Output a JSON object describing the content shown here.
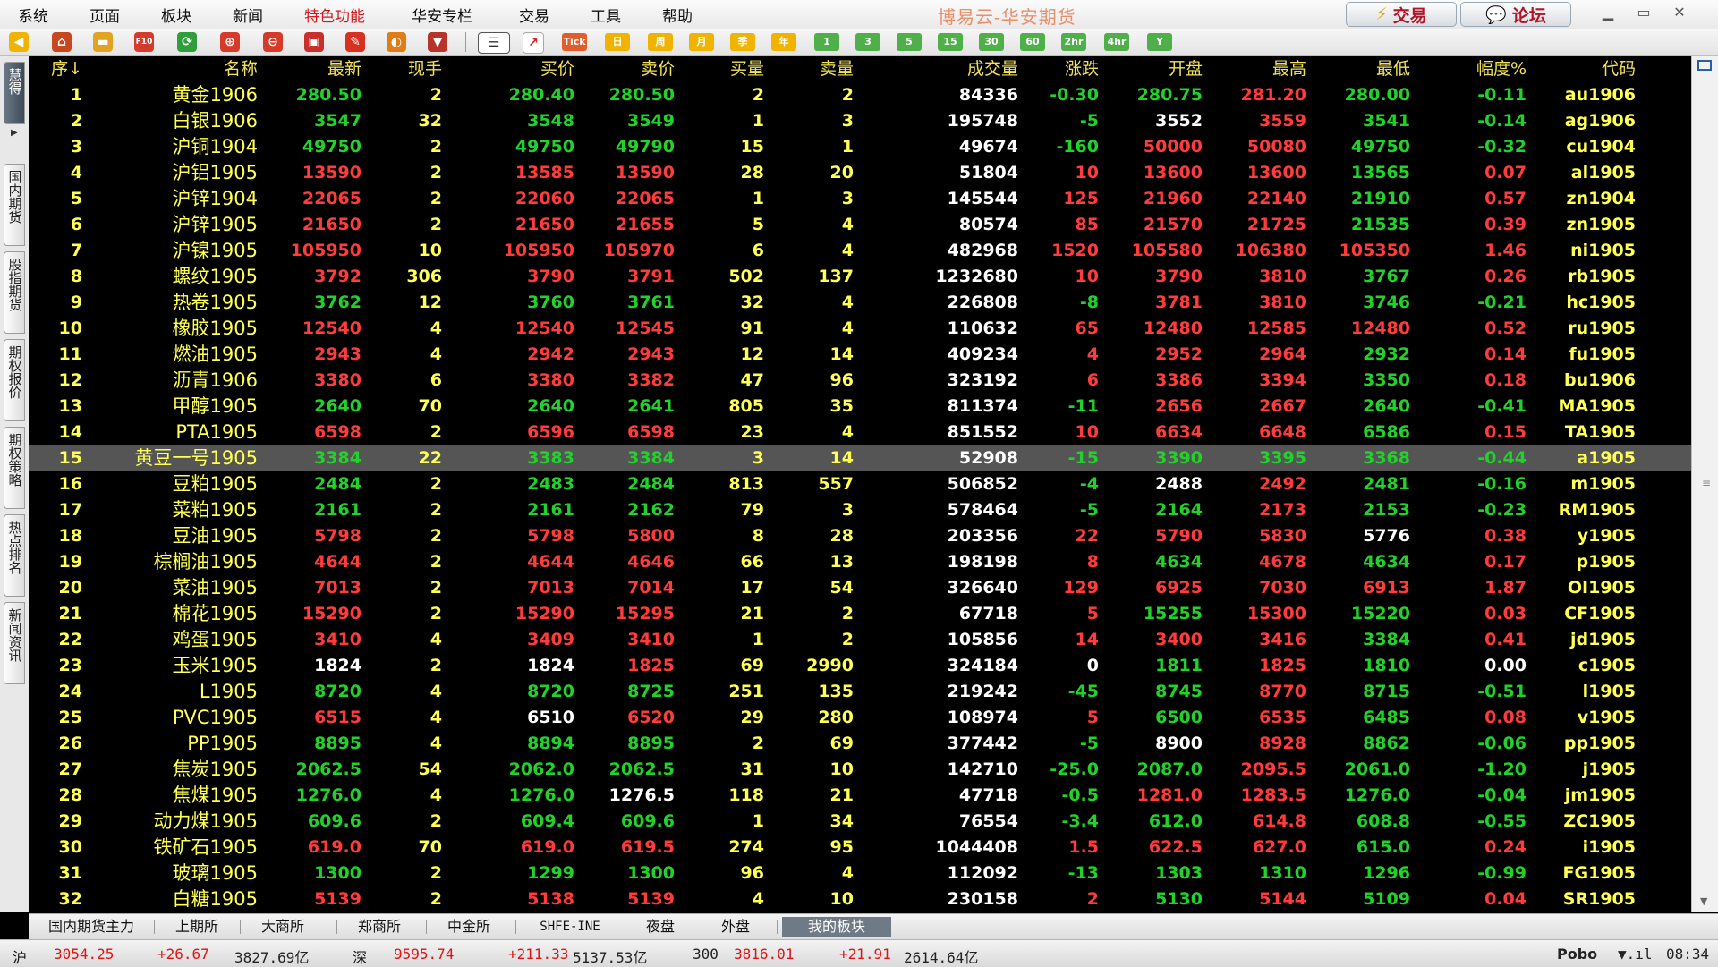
{
  "menu": {
    "items": [
      "系统",
      "页面",
      "板块",
      "新闻",
      "特色功能",
      "华安专栏",
      "交易",
      "工具",
      "帮助"
    ],
    "active_index": 4
  },
  "app_title": "博易云-华安期货",
  "top_buttons": {
    "trade": "交易",
    "forum": "论坛"
  },
  "toolbar": {
    "icons": [
      "back-arrow-icon",
      "home-icon",
      "folder-icon",
      "f10-icon",
      "refresh-icon",
      "zoom-in-icon",
      "zoom-out-icon",
      "window-icon",
      "pen-icon",
      "draw-icon",
      "filter-icon",
      "list-icon",
      "chart-line-icon"
    ],
    "tick_label": "Tick",
    "period_cn": [
      "日",
      "周",
      "月",
      "季",
      "年"
    ],
    "periods": [
      "1",
      "3",
      "5",
      "15",
      "30",
      "60",
      "2hr",
      "4hr",
      "Y"
    ]
  },
  "sidebar": {
    "tabs": [
      "慧得",
      "国内期货",
      "股指期货",
      "期权报价",
      "期权策略",
      "热点排名",
      "新闻资讯"
    ]
  },
  "table": {
    "headers": [
      "序↓",
      "名称",
      "最新",
      "现手",
      "买价",
      "卖价",
      "买量",
      "卖量",
      "成交量",
      "涨跌",
      "开盘",
      "最高",
      "最低",
      "幅度%",
      "代码"
    ],
    "selected_row": 15,
    "rows": [
      [
        "1",
        "黄金1906",
        "280.50",
        "2",
        "280.40",
        "280.50",
        "2",
        "2",
        "84336",
        "-0.30",
        "280.75",
        "281.20",
        "280.00",
        "-0.11",
        "au1906"
      ],
      [
        "2",
        "白银1906",
        "3547",
        "32",
        "3548",
        "3549",
        "1",
        "3",
        "195748",
        "-5",
        "3552",
        "3559",
        "3541",
        "-0.14",
        "ag1906"
      ],
      [
        "3",
        "沪铜1904",
        "49750",
        "2",
        "49750",
        "49790",
        "15",
        "1",
        "49674",
        "-160",
        "50000",
        "50080",
        "49750",
        "-0.32",
        "cu1904"
      ],
      [
        "4",
        "沪铝1905",
        "13590",
        "2",
        "13585",
        "13590",
        "28",
        "20",
        "51804",
        "10",
        "13600",
        "13600",
        "13565",
        "0.07",
        "al1905"
      ],
      [
        "5",
        "沪锌1904",
        "22065",
        "2",
        "22060",
        "22065",
        "1",
        "3",
        "145544",
        "125",
        "21960",
        "22140",
        "21910",
        "0.57",
        "zn1904"
      ],
      [
        "6",
        "沪锌1905",
        "21650",
        "2",
        "21650",
        "21655",
        "5",
        "4",
        "80574",
        "85",
        "21570",
        "21725",
        "21535",
        "0.39",
        "zn1905"
      ],
      [
        "7",
        "沪镍1905",
        "105950",
        "10",
        "105950",
        "105970",
        "6",
        "4",
        "482968",
        "1520",
        "105580",
        "106380",
        "105350",
        "1.46",
        "ni1905"
      ],
      [
        "8",
        "螺纹1905",
        "3792",
        "306",
        "3790",
        "3791",
        "502",
        "137",
        "1232680",
        "10",
        "3790",
        "3810",
        "3767",
        "0.26",
        "rb1905"
      ],
      [
        "9",
        "热卷1905",
        "3762",
        "12",
        "3760",
        "3761",
        "32",
        "4",
        "226808",
        "-8",
        "3781",
        "3810",
        "3746",
        "-0.21",
        "hc1905"
      ],
      [
        "10",
        "橡胶1905",
        "12540",
        "4",
        "12540",
        "12545",
        "91",
        "4",
        "110632",
        "65",
        "12480",
        "12585",
        "12480",
        "0.52",
        "ru1905"
      ],
      [
        "11",
        "燃油1905",
        "2943",
        "4",
        "2942",
        "2943",
        "12",
        "14",
        "409234",
        "4",
        "2952",
        "2964",
        "2932",
        "0.14",
        "fu1905"
      ],
      [
        "12",
        "沥青1906",
        "3380",
        "6",
        "3380",
        "3382",
        "47",
        "96",
        "323192",
        "6",
        "3386",
        "3394",
        "3350",
        "0.18",
        "bu1906"
      ],
      [
        "13",
        "甲醇1905",
        "2640",
        "70",
        "2640",
        "2641",
        "805",
        "35",
        "811374",
        "-11",
        "2656",
        "2667",
        "2640",
        "-0.41",
        "MA1905"
      ],
      [
        "14",
        "PTA1905",
        "6598",
        "2",
        "6596",
        "6598",
        "23",
        "4",
        "851552",
        "10",
        "6634",
        "6648",
        "6586",
        "0.15",
        "TA1905"
      ],
      [
        "15",
        "黄豆一号1905",
        "3384",
        "22",
        "3383",
        "3384",
        "3",
        "14",
        "52908",
        "-15",
        "3390",
        "3395",
        "3368",
        "-0.44",
        "a1905"
      ],
      [
        "16",
        "豆粕1905",
        "2484",
        "2",
        "2483",
        "2484",
        "813",
        "557",
        "506852",
        "-4",
        "2488",
        "2492",
        "2481",
        "-0.16",
        "m1905"
      ],
      [
        "17",
        "菜粕1905",
        "2161",
        "2",
        "2161",
        "2162",
        "79",
        "3",
        "578464",
        "-5",
        "2164",
        "2173",
        "2153",
        "-0.23",
        "RM1905"
      ],
      [
        "18",
        "豆油1905",
        "5798",
        "2",
        "5798",
        "5800",
        "8",
        "28",
        "203356",
        "22",
        "5790",
        "5830",
        "5776",
        "0.38",
        "y1905"
      ],
      [
        "19",
        "棕榈油1905",
        "4644",
        "2",
        "4644",
        "4646",
        "66",
        "13",
        "198198",
        "8",
        "4634",
        "4678",
        "4634",
        "0.17",
        "p1905"
      ],
      [
        "20",
        "菜油1905",
        "7013",
        "2",
        "7013",
        "7014",
        "17",
        "54",
        "326640",
        "129",
        "6925",
        "7030",
        "6913",
        "1.87",
        "OI1905"
      ],
      [
        "21",
        "棉花1905",
        "15290",
        "2",
        "15290",
        "15295",
        "21",
        "2",
        "67718",
        "5",
        "15255",
        "15300",
        "15220",
        "0.03",
        "CF1905"
      ],
      [
        "22",
        "鸡蛋1905",
        "3410",
        "4",
        "3409",
        "3410",
        "1",
        "2",
        "105856",
        "14",
        "3400",
        "3416",
        "3384",
        "0.41",
        "jd1905"
      ],
      [
        "23",
        "玉米1905",
        "1824",
        "2",
        "1824",
        "1825",
        "69",
        "2990",
        "324184",
        "0",
        "1811",
        "1825",
        "1810",
        "0.00",
        "c1905"
      ],
      [
        "24",
        "L1905",
        "8720",
        "4",
        "8720",
        "8725",
        "251",
        "135",
        "219242",
        "-45",
        "8745",
        "8770",
        "8715",
        "-0.51",
        "l1905"
      ],
      [
        "25",
        "PVC1905",
        "6515",
        "4",
        "6510",
        "6520",
        "29",
        "280",
        "108974",
        "5",
        "6500",
        "6535",
        "6485",
        "0.08",
        "v1905"
      ],
      [
        "26",
        "PP1905",
        "8895",
        "4",
        "8894",
        "8895",
        "2",
        "69",
        "377442",
        "-5",
        "8900",
        "8928",
        "8862",
        "-0.06",
        "pp1905"
      ],
      [
        "27",
        "焦炭1905",
        "2062.5",
        "54",
        "2062.0",
        "2062.5",
        "31",
        "10",
        "142710",
        "-25.0",
        "2087.0",
        "2095.5",
        "2061.0",
        "-1.20",
        "j1905"
      ],
      [
        "28",
        "焦煤1905",
        "1276.0",
        "4",
        "1276.0",
        "1276.5",
        "118",
        "21",
        "47718",
        "-0.5",
        "1281.0",
        "1283.5",
        "1276.0",
        "-0.04",
        "jm1905"
      ],
      [
        "29",
        "动力煤1905",
        "609.6",
        "2",
        "609.4",
        "609.6",
        "1",
        "34",
        "76554",
        "-3.4",
        "612.0",
        "614.8",
        "608.8",
        "-0.55",
        "ZC1905"
      ],
      [
        "30",
        "铁矿石1905",
        "619.0",
        "70",
        "619.0",
        "619.5",
        "274",
        "95",
        "1044408",
        "1.5",
        "622.5",
        "627.0",
        "615.0",
        "0.24",
        "i1905"
      ],
      [
        "31",
        "玻璃1905",
        "1300",
        "2",
        "1299",
        "1300",
        "96",
        "4",
        "112092",
        "-13",
        "1303",
        "1310",
        "1296",
        "-0.99",
        "FG1905"
      ],
      [
        "32",
        "白糖1905",
        "5139",
        "2",
        "5138",
        "5139",
        "4",
        "10",
        "230158",
        "2",
        "5130",
        "5144",
        "5109",
        "0.04",
        "SR1905"
      ]
    ]
  },
  "bottom_tabs": {
    "items": [
      "国内期货主力",
      "上期所",
      "大商所",
      "郑商所",
      "中金所",
      "SHFE-INE",
      "夜盘",
      "外盘",
      "我的板块"
    ],
    "active_index": 8
  },
  "status": {
    "sh_label": "沪",
    "sh_index": "3054.25",
    "sh_change": "+26.67",
    "sh_amount": "3827.69亿",
    "sz_label": "深",
    "sz_index": "9595.74",
    "sz_change": "+211.33",
    "sz_amount": "5137.53亿",
    "hs300_label": "300",
    "hs300_index": "3816.01",
    "hs300_change": "+21.91",
    "hs300_amount": "2614.64亿",
    "brand": "Pobo",
    "time": "08:34"
  },
  "colors": {
    "up": "#ff3b3b",
    "down": "#21d22a",
    "flat": "#ffffff",
    "label": "#ffff54",
    "header": "#f0e25a",
    "accent_menu": "#d4161a"
  }
}
